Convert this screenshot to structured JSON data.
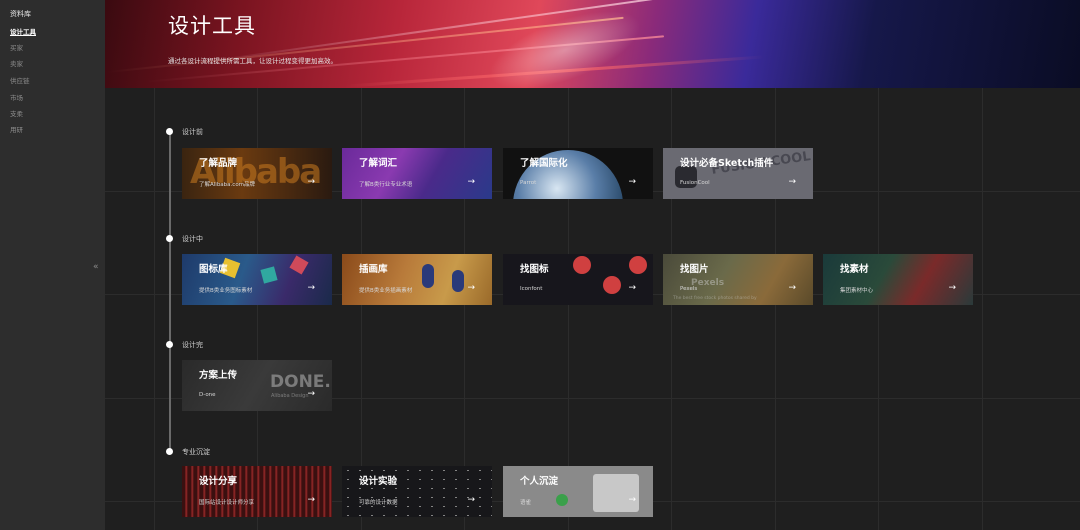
{
  "sidebar": {
    "title": "资料库",
    "items": [
      {
        "label": "设计工具",
        "active": true
      },
      {
        "label": "买家"
      },
      {
        "label": "卖家"
      },
      {
        "label": "供应链"
      },
      {
        "label": "市场"
      },
      {
        "label": "支柔"
      },
      {
        "label": "用研"
      }
    ],
    "collapse_icon": "double-chevron-left-icon",
    "collapse_glyph": "«"
  },
  "hero": {
    "title": "设计工具",
    "subtitle": "通过各设计流程提供所需工具，让设计过程变得更加高效。"
  },
  "sections": [
    {
      "label": "设计前",
      "cards": [
        {
          "title": "了解品牌",
          "desc": "了解Alibaba.com品牌",
          "arrow": "→"
        },
        {
          "title": "了解词汇",
          "desc": "了解B类行业专业术语",
          "arrow": "→"
        },
        {
          "title": "了解国际化",
          "desc": "Parrot",
          "arrow": "→"
        },
        {
          "title": "设计必备Sketch插件",
          "desc": "FusionCool",
          "arrow": "→"
        }
      ]
    },
    {
      "label": "设计中",
      "cards": [
        {
          "title": "图标库",
          "desc": "提供B类业务图标素材",
          "arrow": "→"
        },
        {
          "title": "插画库",
          "desc": "提供B类业务插画素材",
          "arrow": "→"
        },
        {
          "title": "找图标",
          "desc": "Iconfont",
          "arrow": "→"
        },
        {
          "title": "找图片",
          "desc": "Pexels",
          "arrow": "→"
        },
        {
          "title": "找素材",
          "desc": "集团素材中心",
          "arrow": "→"
        }
      ]
    },
    {
      "label": "设计完",
      "cards": [
        {
          "title": "方案上传",
          "desc": "D-one",
          "arrow": "→"
        }
      ]
    },
    {
      "label": "专业沉淀",
      "cards": [
        {
          "title": "设计分享",
          "desc": "国际站设计设计师分享",
          "arrow": "→"
        },
        {
          "title": "设计实验",
          "desc": "可靠的设计数据",
          "arrow": "→"
        },
        {
          "title": "个人沉淀",
          "desc": "语雀",
          "arrow": "→"
        }
      ]
    }
  ],
  "card_images": {
    "brand_word": "Alibaba",
    "fusion_word": "FUSION COOL",
    "pexels_word": "Pexels",
    "pexels_tagline": "The best free stock photos shared by",
    "done_word": "DONE.",
    "done_sub": "Alibaba Design"
  },
  "colors": {
    "sidebar_bg": "#2d2d2d",
    "content_bg": "#1f1f1f",
    "hero_red": "#b8263a",
    "hero_blue": "#16184a",
    "timeline": "#6a6a6a"
  }
}
